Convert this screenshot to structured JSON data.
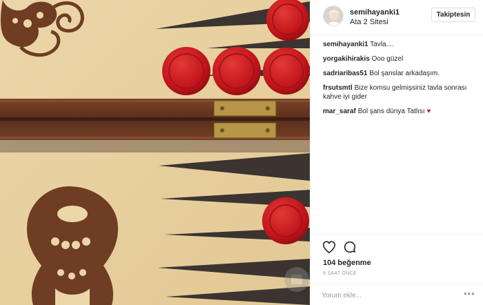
{
  "post": {
    "username": "semihayanki1",
    "location": "Ata 2 Sitesi",
    "follow_label": "Takiptesin"
  },
  "comments": [
    {
      "user": "semihayanki1",
      "text": "Tavla...."
    },
    {
      "user": "yorgakihirakis",
      "text": "Ooo güzel"
    },
    {
      "user": "sadriaribas51",
      "text": "Bol şanslar arkadaşım."
    },
    {
      "user": "frsutsmtl",
      "text": "Bize komsu gelmişsiniz tavla sonrası kahve iyi gider"
    },
    {
      "user": "mar_saraf",
      "text": "Bol şans dünya Tatlısı",
      "emoji": "heart-icon"
    }
  ],
  "actions": {
    "likes": "104 beğenme",
    "time": "8 SAAT ÖNCE",
    "comment_placeholder": "Yorum ekle...",
    "more_label": "•••"
  },
  "colors": {
    "board_light": "#e9d2a4",
    "board_wood": "#6a3a24",
    "checker_red": "#c8161d",
    "point_dark": "#3a3230"
  }
}
